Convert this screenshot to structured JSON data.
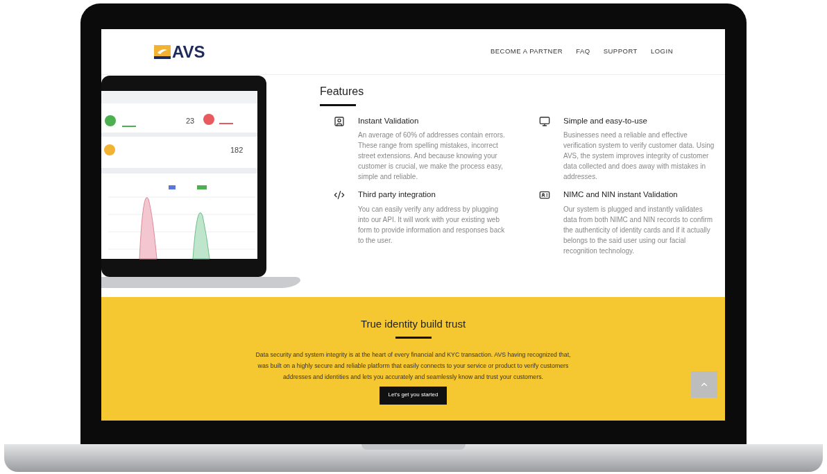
{
  "header": {
    "logo": "AVS",
    "nav": [
      "BECOME A PARTNER",
      "FAQ",
      "SUPPORT",
      "LOGIN"
    ]
  },
  "product_image": {
    "stats": [
      "23",
      "182"
    ]
  },
  "features": {
    "title": "Features",
    "items": [
      {
        "kind": "user-badge",
        "title": "Instant Validation",
        "text": "An average of 60% of addresses contain errors. These range from spelling mistakes, incorrect street extensions. And because knowing your customer is crucial, we make the process easy, simple and reliable."
      },
      {
        "kind": "monitor",
        "title": "Simple and easy-to-use",
        "text": "Businesses need a reliable and effective verification system to verify customer data. Using AVS, the system improves integrity of customer data collected and does away with mistakes in addresses."
      },
      {
        "kind": "code",
        "title": "Third party integration",
        "text": "You can easily verify any address by plugging into our API. It will work with your existing web form to provide information and responses back to the user."
      },
      {
        "kind": "id-card",
        "title": "NIMC and NIN instant Validation",
        "text": "Our system is plugged and instantly validates data from both NIMC and NIN records to confirm the authenticity of identity cards and if it actually belongs to the said user using our facial recognition technology."
      }
    ]
  },
  "cta": {
    "title": "True identity build trust",
    "text": "Data security and system integrity is at the heart of every financial and KYC transaction. AVS having recognized that, was built on a highly secure and reliable platform that easily connects to your service or product to verify customers addresses and identities and lets you accurately and seamlessly know and trust your customers.",
    "button": "Let's get you started"
  }
}
